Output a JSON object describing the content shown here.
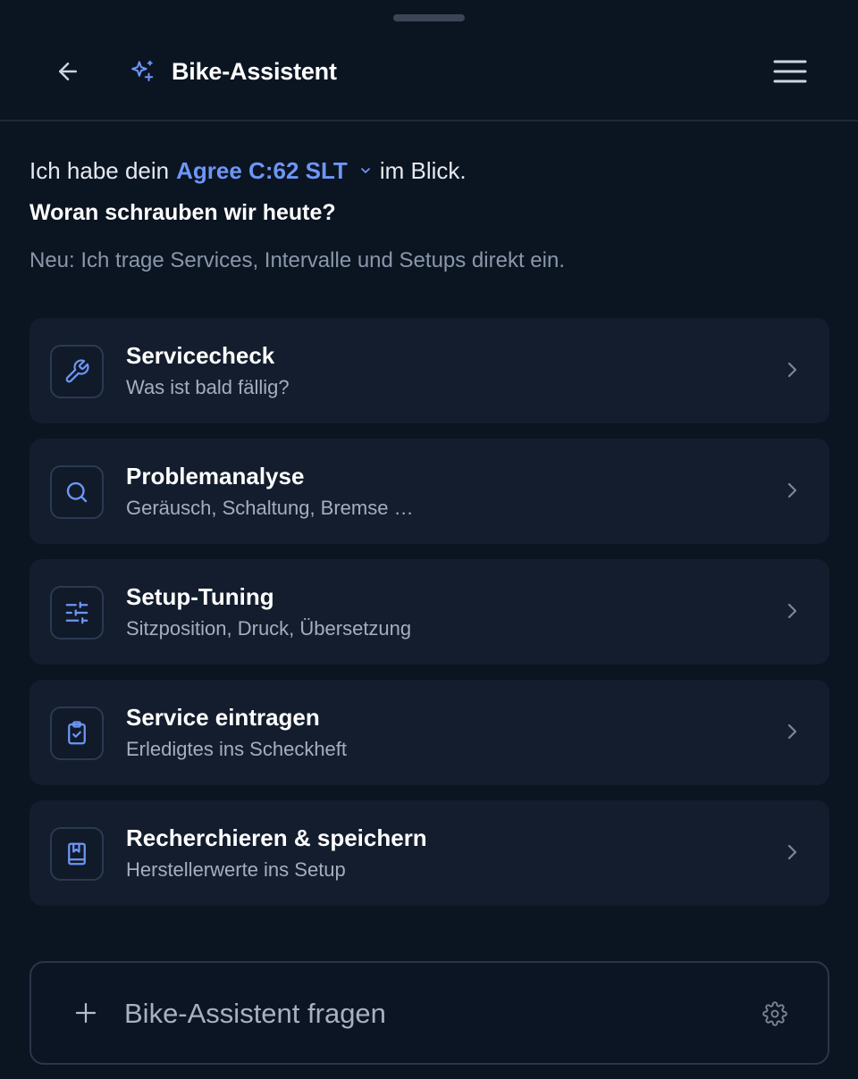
{
  "header": {
    "title": "Bike-Assistent",
    "back_icon": "arrow-left-icon",
    "title_icon": "sparkles-icon",
    "menu_icon": "hamburger-menu-icon"
  },
  "intro": {
    "prefix": "Ich habe dein",
    "bike_name": "Agree C:62 SLT",
    "suffix": "im Blick.",
    "question": "Woran schrauben wir heute?",
    "hint": "Neu: Ich trage Services, Intervalle und Setups direkt ein."
  },
  "cards": [
    {
      "title": "Servicecheck",
      "subtitle": "Was ist bald fällig?",
      "icon": "wrench-icon"
    },
    {
      "title": "Problemanalyse",
      "subtitle": "Geräusch, Schaltung, Bremse …",
      "icon": "search-icon"
    },
    {
      "title": "Setup-Tuning",
      "subtitle": "Sitzposition, Druck, Übersetzung",
      "icon": "sliders-icon"
    },
    {
      "title": "Service eintragen",
      "subtitle": "Erledigtes ins Scheckheft",
      "icon": "clipboard-check-icon"
    },
    {
      "title": "Recherchieren & speichern",
      "subtitle": "Herstellerwerte ins Setup",
      "icon": "bookmark-book-icon"
    }
  ],
  "composer": {
    "placeholder": "Bike-Assistent fragen",
    "value": "",
    "plus_icon": "plus-icon",
    "settings_icon": "gear-icon"
  },
  "colors": {
    "background": "#0b1421",
    "card": "#131d2d",
    "accent": "#6d96f5",
    "muted_text": "#8a97aa"
  }
}
